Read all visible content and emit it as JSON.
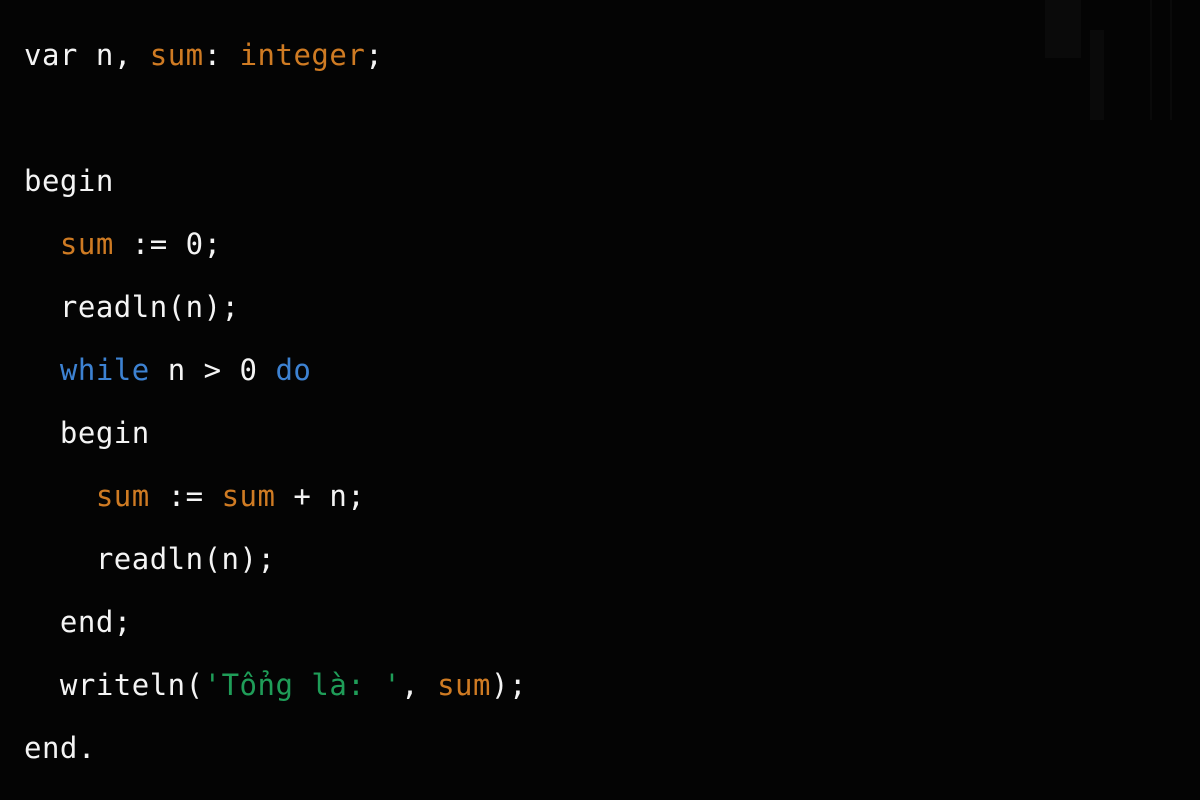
{
  "editor": {
    "language": "Pascal",
    "background_color": "#040404",
    "default_text_color": "#f4f4f4",
    "font_size_px": 29,
    "line_height_px": 63
  },
  "palette": {
    "plain": "#f4f4f4",
    "identifier_highlight": "#cf7b23",
    "keyword": "#3d82d2",
    "string": "#1f9d58",
    "background": "#040404"
  },
  "code": {
    "lines": [
      {
        "index": 1,
        "indent": 0,
        "text": "var n, sum: integer;",
        "tokens": [
          {
            "t": "var",
            "c": "plain"
          },
          {
            "t": " ",
            "c": "plain"
          },
          {
            "t": "n",
            "c": "plain"
          },
          {
            "t": ", ",
            "c": "plain"
          },
          {
            "t": "sum",
            "c": "identifier_highlight"
          },
          {
            "t": ": ",
            "c": "plain"
          },
          {
            "t": "integer",
            "c": "identifier_highlight"
          },
          {
            "t": ";",
            "c": "plain"
          }
        ]
      },
      {
        "index": 2,
        "indent": 0,
        "text": "",
        "tokens": []
      },
      {
        "index": 3,
        "indent": 0,
        "text": "begin",
        "tokens": [
          {
            "t": "begin",
            "c": "plain"
          }
        ]
      },
      {
        "index": 4,
        "indent": 1,
        "text": "  sum := 0;",
        "tokens": [
          {
            "t": "  ",
            "c": "plain"
          },
          {
            "t": "sum",
            "c": "identifier_highlight"
          },
          {
            "t": " := ",
            "c": "plain"
          },
          {
            "t": "0",
            "c": "plain"
          },
          {
            "t": ";",
            "c": "plain"
          }
        ]
      },
      {
        "index": 5,
        "indent": 1,
        "text": "  readln(n);",
        "tokens": [
          {
            "t": "  ",
            "c": "plain"
          },
          {
            "t": "readln(n);",
            "c": "plain"
          }
        ]
      },
      {
        "index": 6,
        "indent": 1,
        "text": "  while n > 0 do",
        "tokens": [
          {
            "t": "  ",
            "c": "plain"
          },
          {
            "t": "while",
            "c": "keyword"
          },
          {
            "t": " n > 0 ",
            "c": "plain"
          },
          {
            "t": "do",
            "c": "keyword"
          }
        ]
      },
      {
        "index": 7,
        "indent": 1,
        "text": "  begin",
        "tokens": [
          {
            "t": "  ",
            "c": "plain"
          },
          {
            "t": "begin",
            "c": "plain"
          }
        ]
      },
      {
        "index": 8,
        "indent": 2,
        "text": "    sum := sum + n;",
        "tokens": [
          {
            "t": "    ",
            "c": "plain"
          },
          {
            "t": "sum",
            "c": "identifier_highlight"
          },
          {
            "t": " := ",
            "c": "plain"
          },
          {
            "t": "sum",
            "c": "identifier_highlight"
          },
          {
            "t": " + n;",
            "c": "plain"
          }
        ]
      },
      {
        "index": 9,
        "indent": 2,
        "text": "    readln(n);",
        "tokens": [
          {
            "t": "    ",
            "c": "plain"
          },
          {
            "t": "readln(n);",
            "c": "plain"
          }
        ]
      },
      {
        "index": 10,
        "indent": 1,
        "text": "  end;",
        "tokens": [
          {
            "t": "  ",
            "c": "plain"
          },
          {
            "t": "end;",
            "c": "plain"
          }
        ]
      },
      {
        "index": 11,
        "indent": 1,
        "text": "  writeln('Tổng là: ', sum);",
        "tokens": [
          {
            "t": "  ",
            "c": "plain"
          },
          {
            "t": "writeln(",
            "c": "plain"
          },
          {
            "t": "'Tổng là: '",
            "c": "string"
          },
          {
            "t": ", ",
            "c": "plain"
          },
          {
            "t": "sum",
            "c": "identifier_highlight"
          },
          {
            "t": ");",
            "c": "plain"
          }
        ]
      },
      {
        "index": 12,
        "indent": 0,
        "text": "end.",
        "tokens": [
          {
            "t": "end.",
            "c": "plain"
          }
        ]
      }
    ]
  }
}
